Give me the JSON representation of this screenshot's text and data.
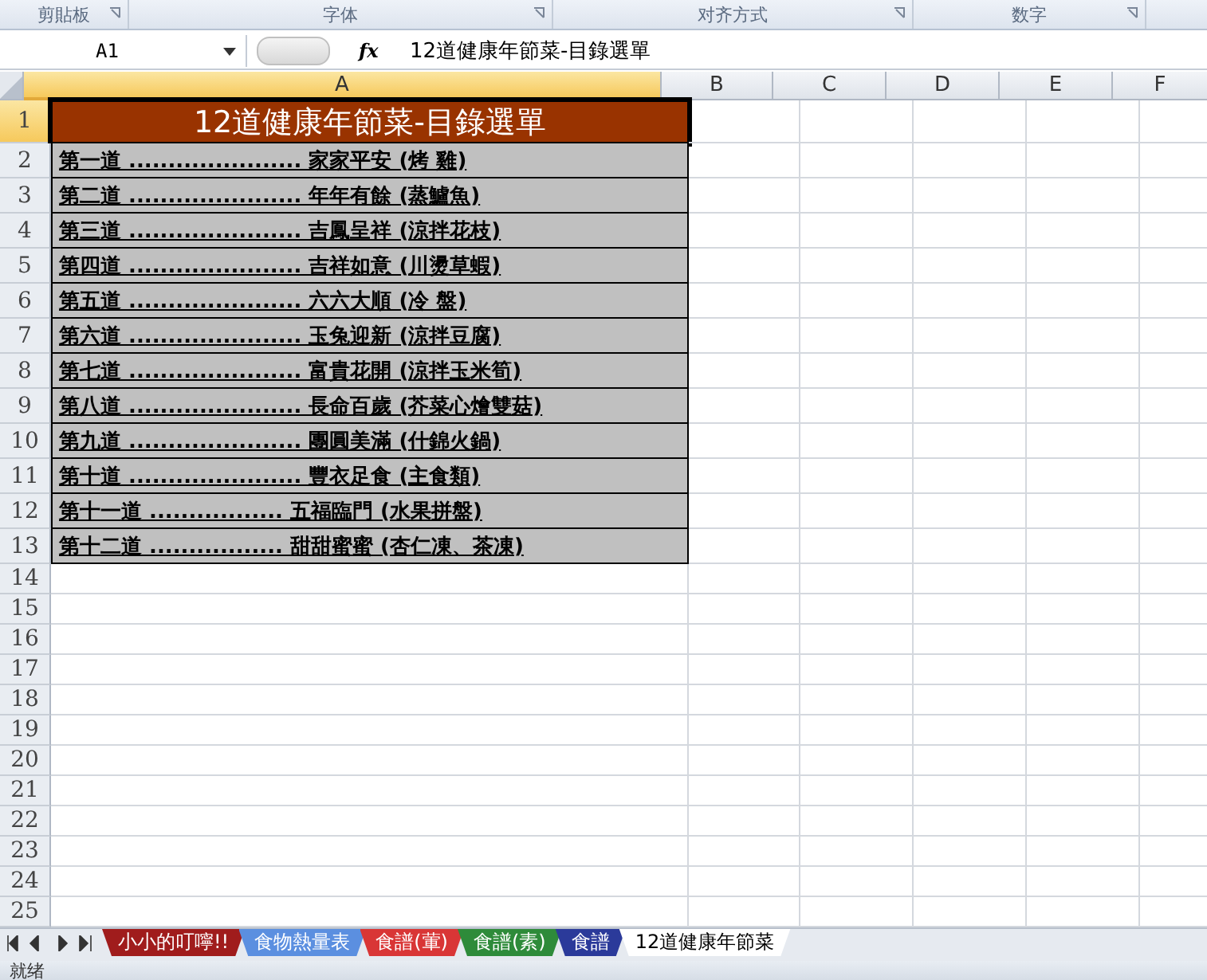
{
  "ribbon_groups": [
    "剪貼板",
    "字体",
    "对齐方式",
    "数字"
  ],
  "name_box": "A1",
  "fx_label": "fx",
  "formula": "12道健康年節菜-目錄選單",
  "columns": [
    {
      "label": "A",
      "selected": true
    },
    {
      "label": "B",
      "selected": false
    },
    {
      "label": "C",
      "selected": false
    },
    {
      "label": "D",
      "selected": false
    },
    {
      "label": "E",
      "selected": false
    },
    {
      "label": "F",
      "selected": false
    }
  ],
  "rows": [
    {
      "number": "1",
      "selected": true,
      "kind": "title",
      "text": "12道健康年節菜-目錄選單"
    },
    {
      "number": "2",
      "selected": false,
      "kind": "item",
      "text": "第一道 ...................... 家家平安 (烤 雞)"
    },
    {
      "number": "3",
      "selected": false,
      "kind": "item",
      "text": "第二道 ...................... 年年有餘 (蒸鱸魚)"
    },
    {
      "number": "4",
      "selected": false,
      "kind": "item",
      "text": "第三道 ...................... 吉鳳呈祥 (涼拌花枝)"
    },
    {
      "number": "5",
      "selected": false,
      "kind": "item",
      "text": "第四道 ...................... 吉祥如意 (川燙草蝦)"
    },
    {
      "number": "6",
      "selected": false,
      "kind": "item",
      "text": "第五道 ...................... 六六大順 (冷 盤)"
    },
    {
      "number": "7",
      "selected": false,
      "kind": "item",
      "text": "第六道 ...................... 玉兔迎新 (涼拌豆腐)"
    },
    {
      "number": "8",
      "selected": false,
      "kind": "item",
      "text": "第七道 ...................... 富貴花開 (涼拌玉米筍)"
    },
    {
      "number": "9",
      "selected": false,
      "kind": "item",
      "text": "第八道 ...................... 長命百歲 (芥菜心燴雙菇)"
    },
    {
      "number": "10",
      "selected": false,
      "kind": "item",
      "text": "第九道 ...................... 團圓美滿 (什錦火鍋)"
    },
    {
      "number": "11",
      "selected": false,
      "kind": "item",
      "text": "第十道 ...................... 豐衣足食 (主食類)"
    },
    {
      "number": "12",
      "selected": false,
      "kind": "item",
      "text": "第十一道 ................. 五福臨門 (水果拼盤)"
    },
    {
      "number": "13",
      "selected": false,
      "kind": "item",
      "text": "第十二道 ................. 甜甜蜜蜜 (杏仁凍、茶凍)"
    },
    {
      "number": "14",
      "selected": false,
      "kind": "empty"
    },
    {
      "number": "15",
      "selected": false,
      "kind": "empty"
    },
    {
      "number": "16",
      "selected": false,
      "kind": "empty"
    },
    {
      "number": "17",
      "selected": false,
      "kind": "empty"
    },
    {
      "number": "18",
      "selected": false,
      "kind": "empty"
    },
    {
      "number": "19",
      "selected": false,
      "kind": "empty"
    },
    {
      "number": "20",
      "selected": false,
      "kind": "empty"
    },
    {
      "number": "21",
      "selected": false,
      "kind": "empty"
    },
    {
      "number": "22",
      "selected": false,
      "kind": "empty"
    },
    {
      "number": "23",
      "selected": false,
      "kind": "empty"
    },
    {
      "number": "24",
      "selected": false,
      "kind": "empty"
    },
    {
      "number": "25",
      "selected": false,
      "kind": "empty"
    }
  ],
  "sheet_tabs": [
    {
      "label": "小小的叮嚀!!",
      "color": "#a01c1c",
      "selected": false
    },
    {
      "label": "食物熱量表",
      "color": "#5b8fe0",
      "selected": false
    },
    {
      "label": "食譜(葷)",
      "color": "#d93636",
      "selected": false
    },
    {
      "label": "食譜(素)",
      "color": "#2e8b3a",
      "selected": false
    },
    {
      "label": "食譜",
      "color": "#2b3a9a",
      "selected": false
    },
    {
      "label": "12道健康年節菜",
      "color": "#ffffff",
      "selected": true
    }
  ],
  "status": "就绪"
}
